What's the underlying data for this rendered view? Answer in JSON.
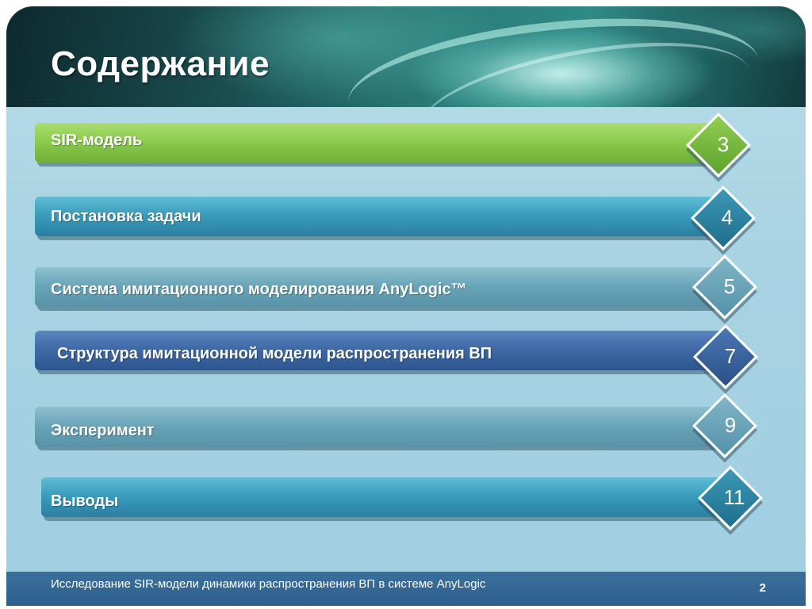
{
  "slide": {
    "title": "Содержание",
    "items": [
      {
        "label": "SIR-модель",
        "page": "3",
        "color": "#8ccc4f"
      },
      {
        "label": "Постановка задачи",
        "page": "4",
        "color": "#3a9dbc"
      },
      {
        "label": "Система имитационного моделирования AnyLogic™",
        "page": "5",
        "color": "#6aa6ba"
      },
      {
        "label": "Структура имитационной модели распространения ВП",
        "page": "7",
        "color": "#3f6aa6"
      },
      {
        "label": "Эксперимент",
        "page": "9",
        "color": "#6aa6ba"
      },
      {
        "label": "Выводы",
        "page": "11",
        "color": "#3a9dbc"
      }
    ]
  },
  "footer": {
    "text": "Исследование SIR-модели динамики распространения ВП в системе AnyLogic",
    "page_number": "2"
  }
}
